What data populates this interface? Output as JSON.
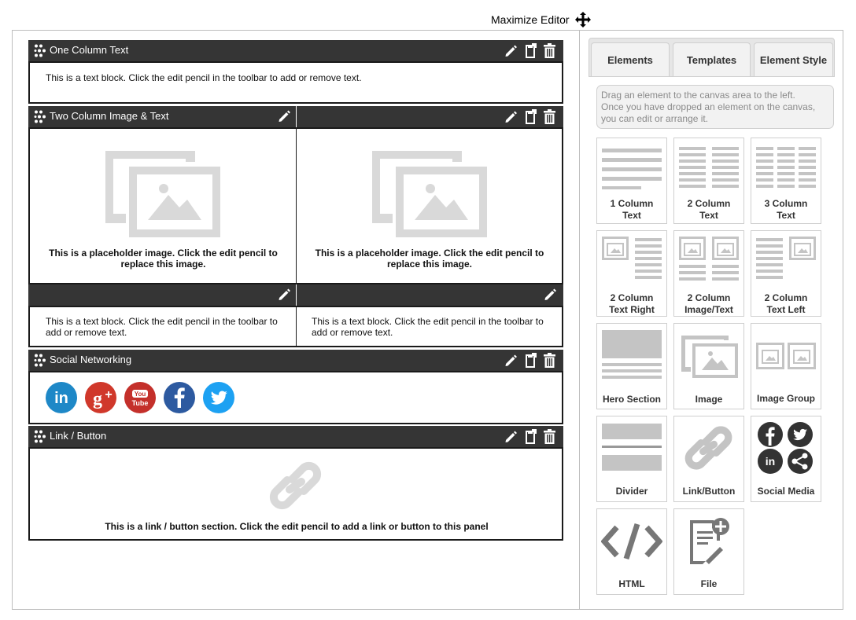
{
  "header": {
    "maximize_label": "Maximize Editor"
  },
  "canvas": {
    "one_column": {
      "title": "One Column Text",
      "text": "This is a text block. Click the edit pencil in the toolbar to add or remove text."
    },
    "two_column": {
      "title": "Two Column Image & Text",
      "placeholder_line1": "This is a placeholder image. Click the edit pencil to",
      "placeholder_line2": "replace this image.",
      "text_line1": "This is a text block. Click the edit pencil in the toolbar to",
      "text_line2": "add or remove text."
    },
    "social": {
      "title": "Social Networking",
      "icons": [
        "linkedin-icon",
        "google-plus-icon",
        "youtube-icon",
        "facebook-icon",
        "twitter-icon"
      ],
      "colors": {
        "linkedin": "#1e88c7",
        "google_plus": "#d0382b",
        "youtube": "#c4302b",
        "facebook": "#2d5aa0",
        "twitter": "#1da1f2"
      },
      "youtube_top": "You",
      "youtube_bottom": "Tube"
    },
    "link_button": {
      "title": "Link / Button",
      "text": "This is a link / button section. Click the edit pencil to add a link or button to this panel"
    }
  },
  "panel": {
    "tabs": [
      "Elements",
      "Templates",
      "Element Style"
    ],
    "hint_lines": [
      "Drag an element to the canvas area to the left.",
      "Once you have dropped an element on the canvas,",
      "you can edit or arrange it."
    ],
    "elements": [
      {
        "line1": "1 Column",
        "line2": "Text"
      },
      {
        "line1": "2 Column",
        "line2": "Text"
      },
      {
        "line1": "3 Column",
        "line2": "Text"
      },
      {
        "line1": "2 Column",
        "line2": "Text Right"
      },
      {
        "line1": "2 Column",
        "line2": "Image/Text"
      },
      {
        "line1": "2 Column",
        "line2": "Text Left"
      },
      {
        "line1": "Hero Section",
        "line2": ""
      },
      {
        "line1": "Image",
        "line2": ""
      },
      {
        "line1": "Image Group",
        "line2": ""
      },
      {
        "line1": "Divider",
        "line2": ""
      },
      {
        "line1": "Link/Button",
        "line2": ""
      },
      {
        "line1": "Social Media",
        "line2": ""
      },
      {
        "line1": "HTML",
        "line2": ""
      },
      {
        "line1": "File",
        "line2": ""
      }
    ],
    "social_tile_in": "in"
  },
  "colors": {
    "toolbar": "#353535",
    "placeholder_gray": "#d9d9d9",
    "tile_gray": "#c4c4c4",
    "dark_icon": "#333333"
  }
}
